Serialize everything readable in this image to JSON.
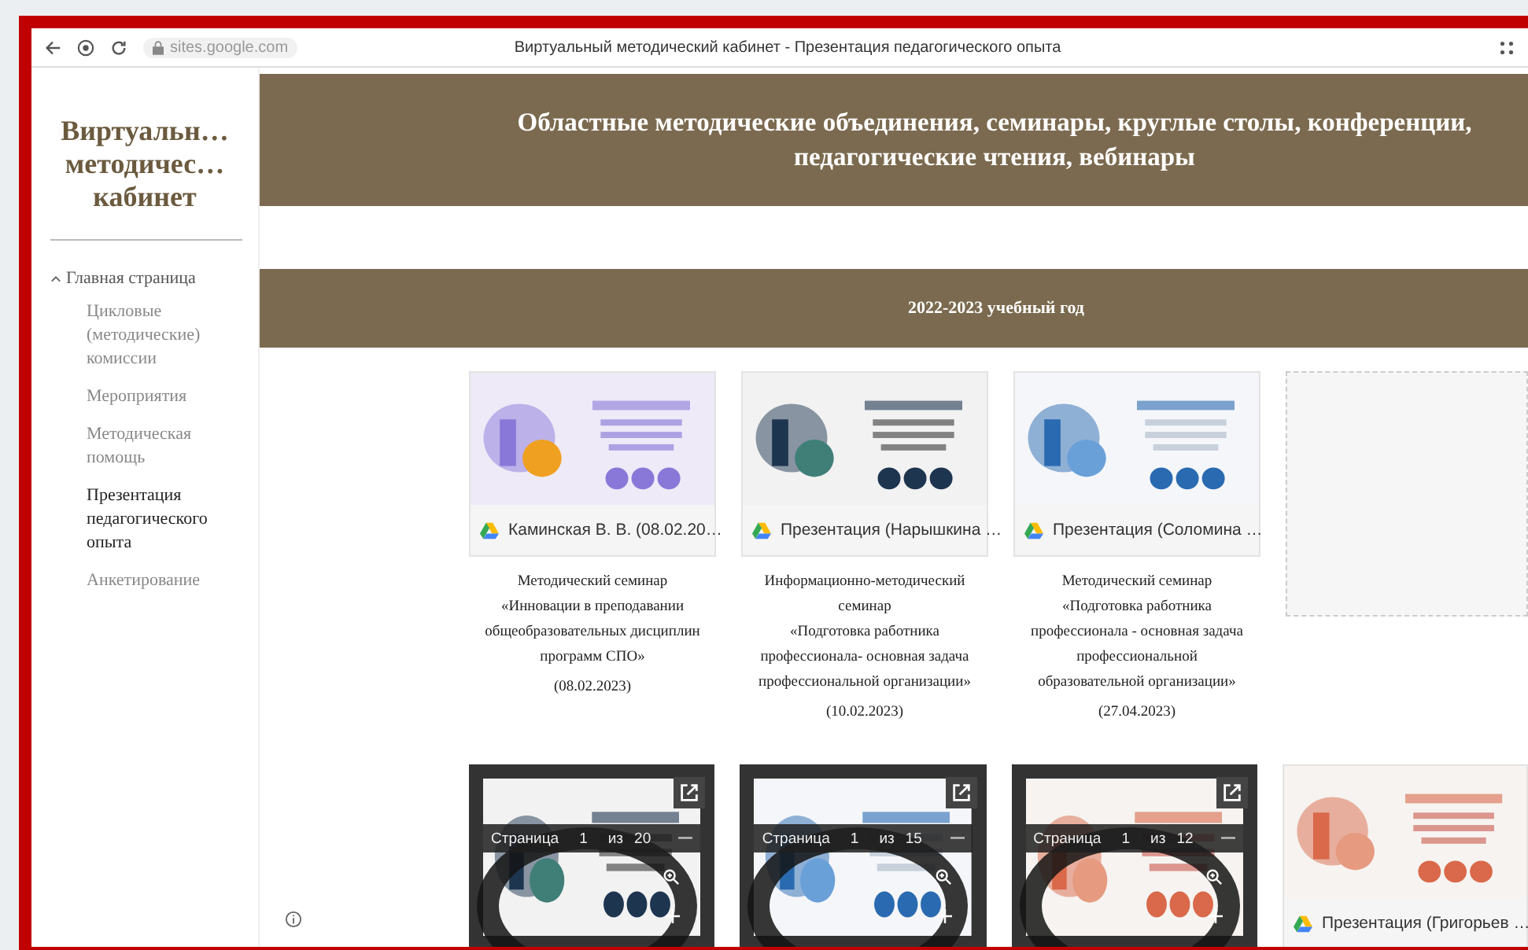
{
  "browser": {
    "url": "sites.google.com",
    "title": "Виртуальный методический кабинет - Презентация педагогического опыта"
  },
  "site_title": [
    "Виртуальн…",
    "методичес…",
    "кабинет"
  ],
  "nav": {
    "label": "Главная страница",
    "expanded": true,
    "children": [
      {
        "label": "Цикловые (методические) комиссии",
        "selected": false
      },
      {
        "label": "Мероприятия",
        "selected": false
      },
      {
        "label": "Методическая помощь",
        "selected": false
      },
      {
        "label": "Презентация педагогического опыта",
        "selected": true
      },
      {
        "label": "Анкетирование",
        "selected": false
      }
    ]
  },
  "header": "Областные методические объединения, семинары, круглые столы, конференции, педагогические чтения, вебинары",
  "year_band": "2022-2023 учебный год",
  "cards_row_1": [
    {
      "kind": "file",
      "file_label": "Каминская В. В. (08.02.20…",
      "caption": [
        "Методический семинар",
        "«Инновации в преподавании",
        "общеобразовательных дисциплин",
        "программ СПО»"
      ],
      "date": "(08.02.2023)"
    },
    {
      "kind": "file",
      "file_label": "Презентация (Нарышкина …",
      "caption": [
        "Информационно-методический",
        "семинар",
        "«Подготовка работника",
        "профессионала- основная задача",
        "профессиональной организации»"
      ],
      "date": "(10.02.2023)"
    },
    {
      "kind": "file",
      "file_label": "Презентация (Соломина …",
      "caption": [
        "Методический семинар",
        "«Подготовка работника",
        "профессионала - основная задача",
        "профессиональной",
        "образовательной организации»"
      ],
      "date": "(27.04.2023)"
    },
    {
      "kind": "placeholder"
    }
  ],
  "cards_row_2": [
    {
      "kind": "viewer",
      "page_word": "Страница",
      "page": "1",
      "of_word": "из",
      "total": "20"
    },
    {
      "kind": "viewer",
      "page_word": "Страница",
      "page": "1",
      "of_word": "из",
      "total": "15"
    },
    {
      "kind": "viewer",
      "page_word": "Страница",
      "page": "1",
      "of_word": "из",
      "total": "12"
    },
    {
      "kind": "file",
      "file_label": "Презентация (Григорьев …"
    }
  ]
}
